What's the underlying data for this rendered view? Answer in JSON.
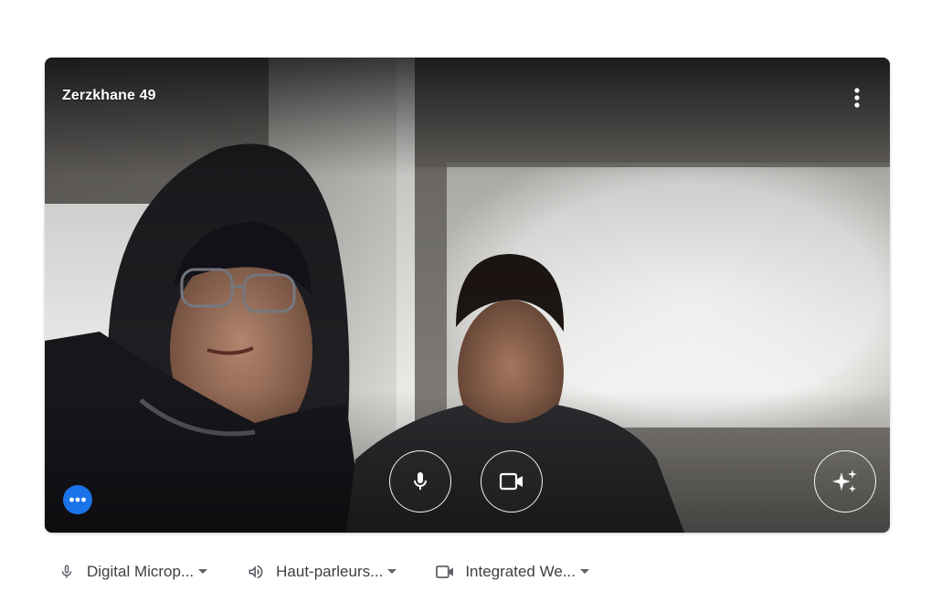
{
  "participant": {
    "name": "Zerzkhane 49"
  },
  "preview_controls": {
    "more_options_icon": "more-vert-icon",
    "microphone_icon": "mic-icon",
    "camera_icon": "videocam-icon",
    "effects_icon": "sparkle-icon",
    "more_actions_icon": "more-horiz-icon"
  },
  "devices": [
    {
      "icon": "mic-icon",
      "label": "Digital Microp..."
    },
    {
      "icon": "speaker-icon",
      "label": "Haut-parleurs..."
    },
    {
      "icon": "videocam-icon",
      "label": "Integrated We..."
    }
  ],
  "colors": {
    "accent_blue": "#1a73e8",
    "device_text": "#3c4043",
    "control_border": "#ffffff"
  }
}
